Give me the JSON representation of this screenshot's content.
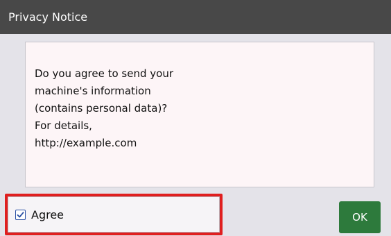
{
  "window": {
    "title": "Privacy Notice"
  },
  "message": {
    "lines": [
      "Do you agree to send your",
      "machine's information",
      "(contains personal data)?",
      "For details,",
      "http://example.com"
    ]
  },
  "agree": {
    "label": "Agree",
    "checked": true,
    "icon": "checkmark-icon"
  },
  "actions": {
    "ok_label": "OK"
  },
  "colors": {
    "titlebar": "#484848",
    "background": "#e4e3e9",
    "ok_button": "#2d7a3c",
    "highlight": "#e01f1f",
    "checkbox_accent": "#2a4fa3"
  }
}
